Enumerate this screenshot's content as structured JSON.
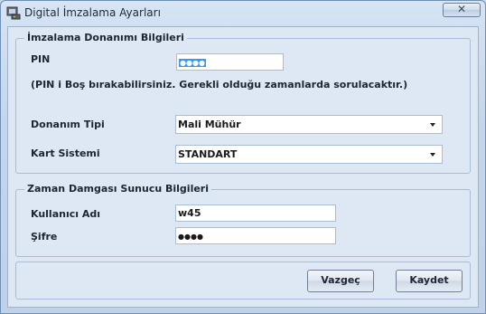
{
  "window": {
    "title": "Digital İmzalama Ayarları",
    "close_glyph": "✕"
  },
  "hardware_group": {
    "legend": "İmzalama Donanımı Bilgileri",
    "pin_label": "PIN",
    "pin_value": "●●●●",
    "pin_note": "(PIN i Boş bırakabilirsiniz. Gerekli olduğu zamanlarda sorulacaktır.)",
    "hardware_type_label": "Donanım Tipi",
    "hardware_type_value": "Mali Mühür",
    "card_system_label": "Kart Sistemi",
    "card_system_value": "STANDART"
  },
  "timestamp_group": {
    "legend": "Zaman Damgası Sunucu Bilgileri",
    "username_label": "Kullanıcı Adı",
    "username_value": "w45",
    "password_label": "Şifre",
    "password_value": "●●●●"
  },
  "buttons": {
    "cancel": "Vazgeç",
    "save": "Kaydet"
  },
  "icons": {
    "app": "certificate-terminal-icon",
    "close": "close-icon",
    "dropdown": "chevron-down-icon"
  },
  "colors": {
    "selection": "#3399ff",
    "window_bg": "#dde8f4",
    "frame": "#c4d6eb"
  }
}
